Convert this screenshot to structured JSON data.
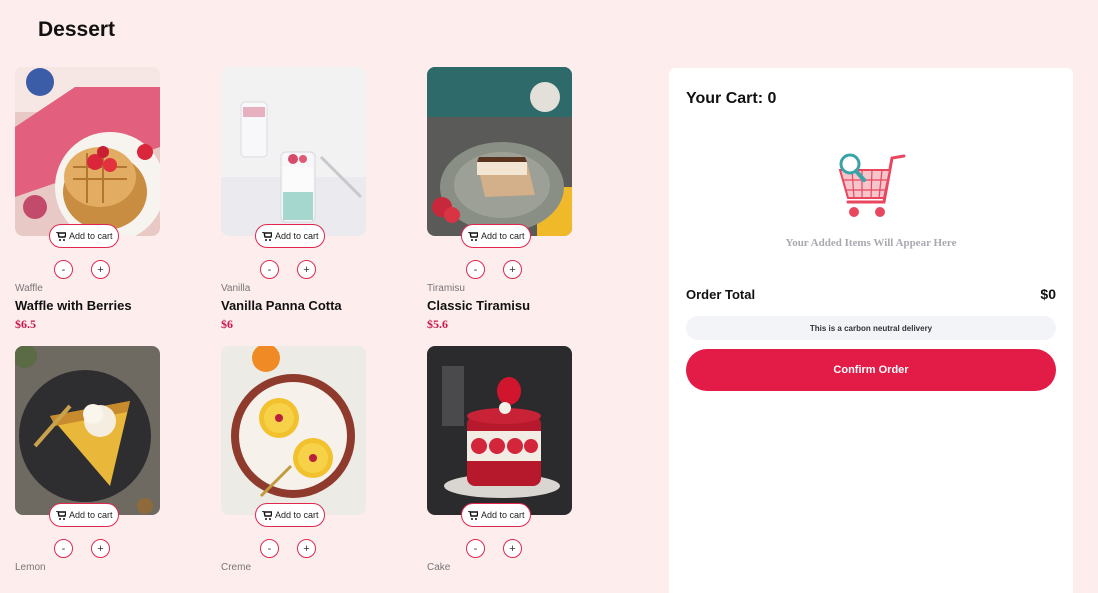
{
  "page": {
    "title": "Dessert"
  },
  "products": [
    {
      "category": "Waffle",
      "name": "Waffle with Berries",
      "price": "$6.5",
      "add_label": "Add to cart",
      "minus": "-",
      "plus": "+",
      "image": "waffle-with-berries-image"
    },
    {
      "category": "Vanilla",
      "name": "Vanilla Panna Cotta",
      "price": "$6",
      "add_label": "Add to cart",
      "minus": "-",
      "plus": "+",
      "image": "panna-cotta-image"
    },
    {
      "category": "Tiramisu",
      "name": "Classic Tiramisu",
      "price": "$5.6",
      "add_label": "Add to cart",
      "minus": "-",
      "plus": "+",
      "image": "tiramisu-image"
    },
    {
      "category": "Lemon",
      "name": "",
      "price": "",
      "add_label": "Add to cart",
      "minus": "-",
      "plus": "+",
      "image": "lemon-tart-image"
    },
    {
      "category": "Creme",
      "name": "",
      "price": "",
      "add_label": "Add to cart",
      "minus": "-",
      "plus": "+",
      "image": "creme-brulee-image"
    },
    {
      "category": "Cake",
      "name": "",
      "price": "",
      "add_label": "Add to cart",
      "minus": "-",
      "plus": "+",
      "image": "red-velvet-cake-image"
    }
  ],
  "cart": {
    "title": "Your Cart: 0",
    "empty_message": "Your Added Items Will Appear Here",
    "order_total_label": "Order Total",
    "order_total_value": "$0",
    "carbon_note": "This is a carbon neutral delivery",
    "confirm_label": "Confirm Order"
  },
  "colors": {
    "background": "#fdeded",
    "accent": "#e31b47",
    "price": "#c8174a"
  },
  "icons": {
    "add_to_cart": "cart-icon",
    "empty_cart": "empty-cart-icon"
  }
}
